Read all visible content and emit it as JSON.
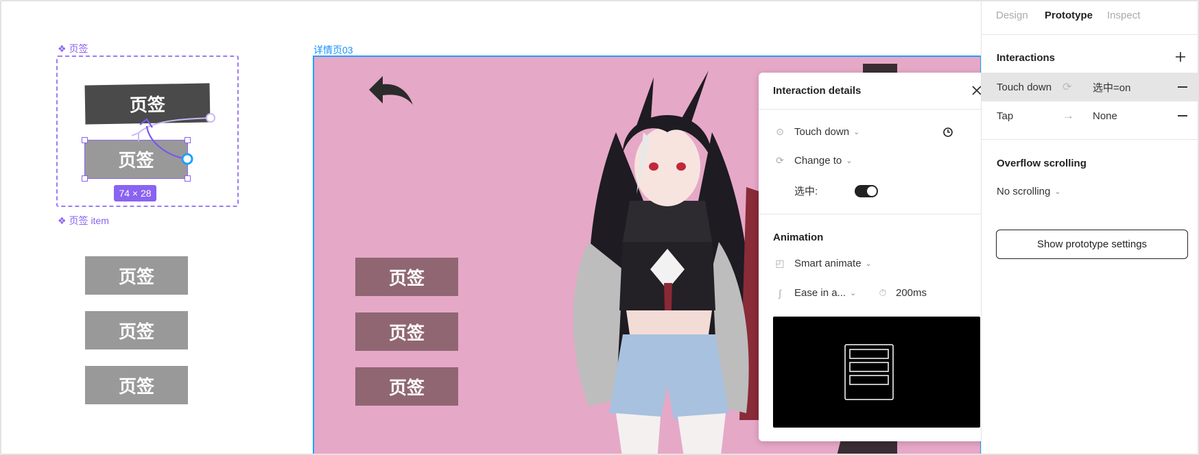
{
  "canvas": {
    "component_label": "页签",
    "item_label": "页签 item",
    "size_badge": "74 × 28",
    "tab_text": "页签",
    "frame_label": "详情页03",
    "frame_bg": "#e6a8c7"
  },
  "panel": {
    "tabs": [
      "Design",
      "Prototype",
      "Inspect"
    ],
    "interactions_title": "Interactions",
    "interactions": [
      {
        "trigger": "Touch down",
        "action_icon": "change-to-icon",
        "target": "选中=on"
      },
      {
        "trigger": "Tap",
        "action_icon": "arrow-right-icon",
        "target": "None"
      }
    ],
    "overflow_title": "Overflow scrolling",
    "overflow_value": "No scrolling",
    "settings_button": "Show prototype settings"
  },
  "popup": {
    "title": "Interaction details",
    "trigger": "Touch down",
    "action": "Change to",
    "property_label": "选中:",
    "toggle_on": true,
    "animation_title": "Animation",
    "animation_type": "Smart animate",
    "easing": "Ease in a...",
    "duration": "200ms"
  },
  "colors": {
    "accent_purple": "#8a63f2",
    "frame_blue": "#1ea0ff",
    "tab_dark": "#4a4a4a",
    "tab_grey": "#999999",
    "tab_plum": "#906672"
  }
}
